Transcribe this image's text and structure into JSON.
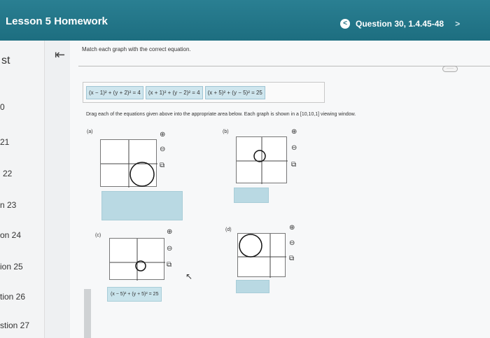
{
  "header": {
    "title": "Lesson 5 Homework",
    "prev_label": "<",
    "question": "Question 30, 1.4.45-48",
    "next_label": ">"
  },
  "sidebar": {
    "items": [
      {
        "label": "st"
      },
      {
        "label": "0"
      },
      {
        "label": "21"
      },
      {
        "label": "22"
      },
      {
        "label": "n 23"
      },
      {
        "label": "on 24"
      },
      {
        "label": "ion 25"
      },
      {
        "label": "tion 26"
      },
      {
        "label": "stion 27"
      }
    ]
  },
  "collapse_icon": "collapse-left-icon",
  "prompt": "Match each graph with the correct equation.",
  "more_label": "·····",
  "equations": [
    {
      "text": "(x − 1)² + (y + 2)² = 4"
    },
    {
      "text": "(x + 1)² + (y − 2)² = 4"
    },
    {
      "text": "(x + 5)² + (y − 5)² = 25"
    }
  ],
  "instructions": "Drag each of the equations given above into the appropriate area below. Each graph is shown in a [10,10,1] viewing window.",
  "graphs": {
    "a": {
      "label": "(a)"
    },
    "b": {
      "label": "(b)"
    },
    "c": {
      "label": "(c)",
      "dropped": "(x − 5)² + (y + 5)² = 25"
    },
    "d": {
      "label": "(d)"
    }
  },
  "icons": {
    "zoom_in": "zoom-in-icon",
    "zoom_out": "zoom-out-icon",
    "popout": "popout-icon"
  },
  "accent_color": "#1d6e80"
}
